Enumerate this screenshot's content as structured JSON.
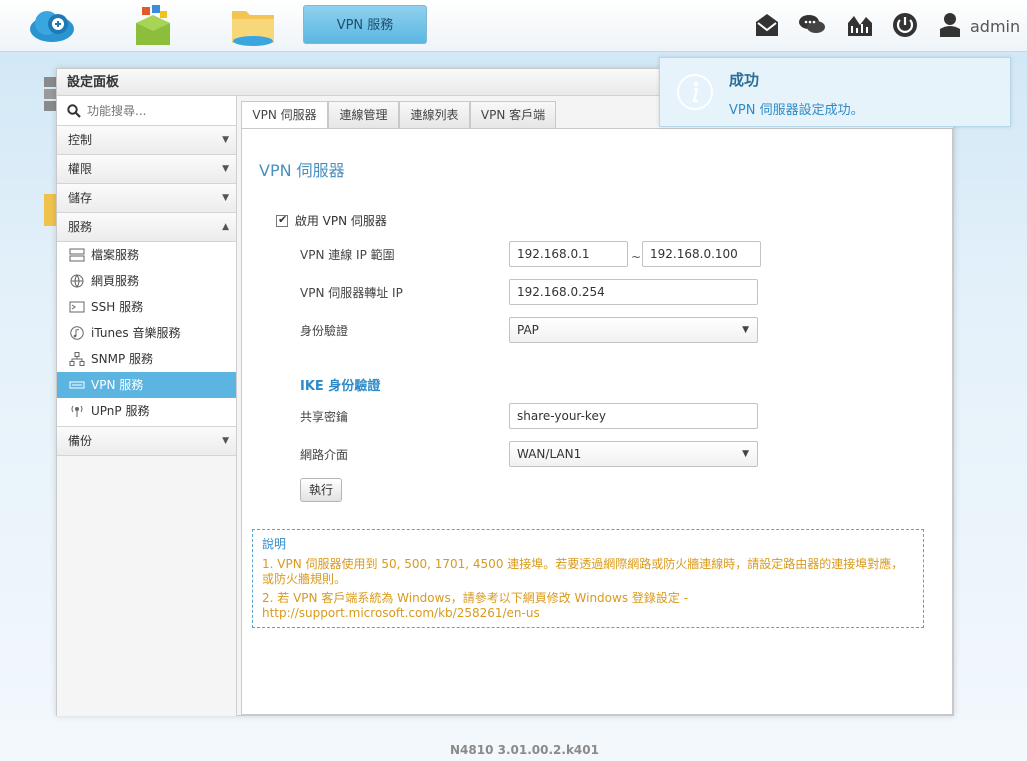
{
  "topbar": {
    "task_button": "VPN 服務",
    "user": "admin"
  },
  "panel": {
    "title": "設定面板",
    "search_placeholder": "功能搜尋...",
    "sections": {
      "control": "控制",
      "permission": "權限",
      "storage": "儲存",
      "service": "服務",
      "backup": "備份"
    },
    "service_items": [
      {
        "label": "檔案服務",
        "icon": "file-server-icon"
      },
      {
        "label": "網頁服務",
        "icon": "web-globe-icon"
      },
      {
        "label": "SSH 服務",
        "icon": "terminal-icon"
      },
      {
        "label": "iTunes 音樂服務",
        "icon": "music-note-icon"
      },
      {
        "label": "SNMP 服務",
        "icon": "network-tree-icon"
      },
      {
        "label": "VPN 服務",
        "icon": "vpn-icon"
      },
      {
        "label": "UPnP 服務",
        "icon": "antenna-icon"
      }
    ]
  },
  "tabs": [
    "VPN 伺服器",
    "連線管理",
    "連線列表",
    "VPN 客戶端"
  ],
  "content": {
    "title": "VPN 伺服器",
    "enable_label": "啟用 VPN 伺服器",
    "ip_range_label": "VPN 連線 IP 範圍",
    "ip_start": "192.168.0.1",
    "ip_sep": "~",
    "ip_end": "192.168.0.100",
    "forward_label": "VPN 伺服器轉址 IP",
    "forward_ip": "192.168.0.254",
    "auth_label": "身份驗證",
    "auth_value": "PAP",
    "ike_title": "IKE 身份驗證",
    "psk_label": "共享密鑰",
    "psk_value": "share-your-key",
    "iface_label": "網路介面",
    "iface_value": "WAN/LAN1",
    "execute": "執行"
  },
  "notes": {
    "title": "說明",
    "line1": "1. VPN 伺服器使用到 50, 500, 1701, 4500 連接埠。若要透過網際網路或防火牆連線時，請設定路由器的連接埠對應，或防火牆規則。",
    "line2": "2. 若 VPN 客戶端系統為 Windows，請參考以下網頁修改 Windows 登錄設定 - http://support.microsoft.com/kb/258261/en-us"
  },
  "toast": {
    "title": "成功",
    "message": "VPN 伺服器設定成功。"
  },
  "footer": {
    "version": "N4810   3.01.00.2.k401"
  }
}
